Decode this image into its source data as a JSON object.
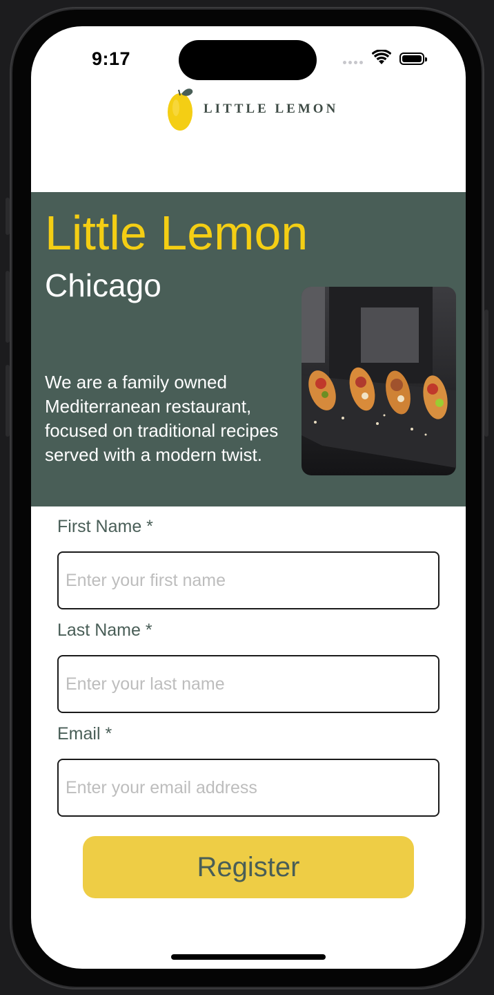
{
  "status_bar": {
    "time": "9:17"
  },
  "brand": {
    "logo_text": "LITTLE LEMON"
  },
  "hero": {
    "title": "Little Lemon",
    "city": "Chicago",
    "description": "We are a family owned Mediterranean restaurant, focused on traditional recipes served with a modern twist."
  },
  "form": {
    "first_name": {
      "label": "First Name *",
      "placeholder": "Enter your first name",
      "value": ""
    },
    "last_name": {
      "label": "Last Name *",
      "placeholder": "Enter your last name",
      "value": ""
    },
    "email": {
      "label": "Email *",
      "placeholder": "Enter your email address",
      "value": ""
    },
    "register_label": "Register"
  },
  "colors": {
    "primary_green": "#495e57",
    "primary_yellow": "#f4ce14",
    "button_yellow": "#eecd45"
  },
  "icons": [
    "wifi-icon",
    "battery-icon",
    "cellular-signal-icon",
    "lemon-logo-icon"
  ]
}
